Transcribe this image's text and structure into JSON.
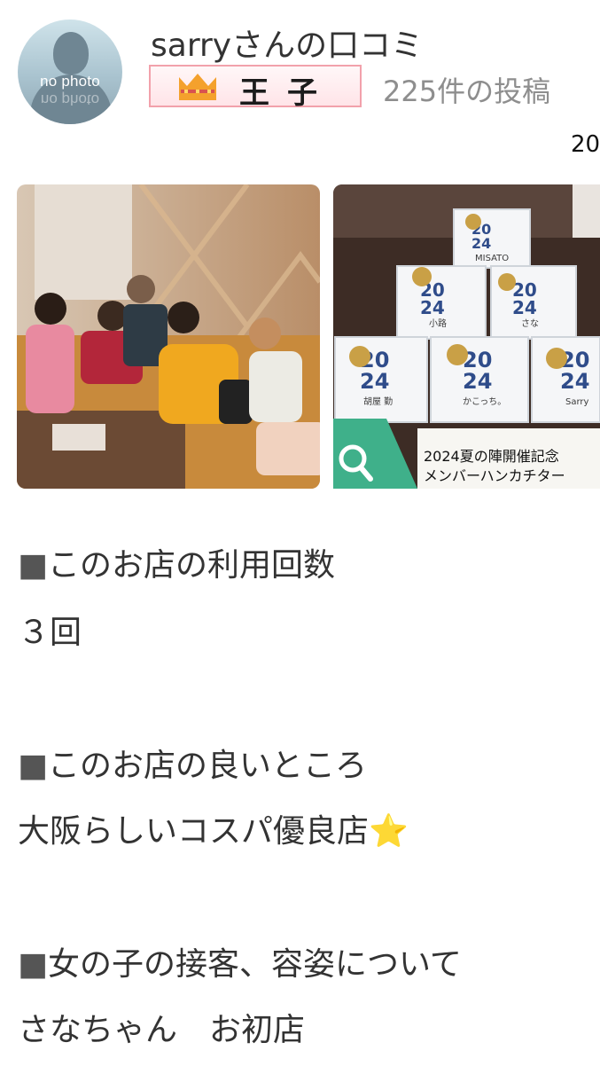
{
  "header": {
    "avatar_text": "no photo",
    "title": "sarryさんの口コミ",
    "rank_label": "王子",
    "post_count": "225件の投稿",
    "date_peek": "20"
  },
  "photos": {
    "caption_line1": "2024夏の陣開催記念",
    "caption_line2": "メンバーハンカチター",
    "handkerchief_names": [
      "MISATO",
      "小路",
      "さな",
      "胡屋 勤",
      "かこっち。",
      "Sarry"
    ],
    "handkerchief_year": "2024"
  },
  "review": {
    "q1": "このお店の利用回数",
    "a1": "３回",
    "q2": "このお店の良いところ",
    "a2": "大阪らしいコスパ優良店",
    "q3": "女の子の接客、容姿について",
    "a3": "さなちゃん　お初店",
    "bullet": "■",
    "star": "⭐"
  },
  "colors": {
    "badge_border": "#f2a1ab",
    "crown": "#f4a12d",
    "zoom_badge": "#3fb08a",
    "text": "#333333",
    "muted": "#8e8e8e"
  }
}
